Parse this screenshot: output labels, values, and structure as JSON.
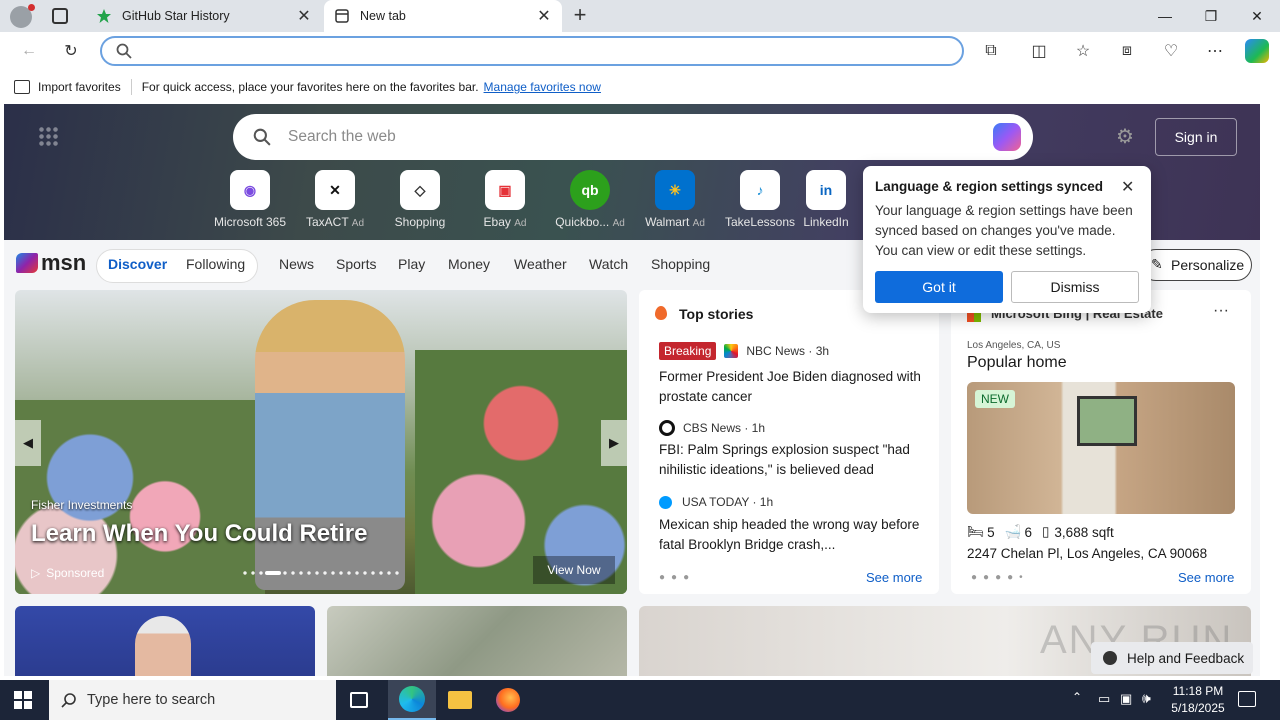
{
  "tabs": [
    {
      "label": "GitHub Star History"
    },
    {
      "label": "New tab"
    }
  ],
  "favbar": {
    "import_label": "Import favorites",
    "message": "For quick access, place your favorites here on the favorites bar.",
    "manage_link": "Manage favorites now"
  },
  "hero": {
    "search_placeholder": "Search the web",
    "signin": "Sign in"
  },
  "quicklinks": [
    {
      "label": "Microsoft 365",
      "ad": ""
    },
    {
      "label": "TaxACT",
      "ad": "Ad"
    },
    {
      "label": "Shopping",
      "ad": ""
    },
    {
      "label": "Ebay",
      "ad": "Ad"
    },
    {
      "label": "Quickbo...",
      "ad": "Ad"
    },
    {
      "label": "Walmart",
      "ad": "Ad"
    },
    {
      "label": "TakeLessons",
      "ad": ""
    },
    {
      "label": "LinkedIn",
      "ad": ""
    }
  ],
  "msn": {
    "logo": "msn",
    "discover": "Discover",
    "following": "Following",
    "personalize": "Personalize",
    "nav": [
      "News",
      "Sports",
      "Play",
      "Money",
      "Weather",
      "Watch",
      "Shopping"
    ]
  },
  "hero_card": {
    "source": "Fisher Investments",
    "headline": "Learn When You Could Retire",
    "sponsored": "Sponsored",
    "cta": "View Now"
  },
  "top_stories": {
    "title": "Top stories",
    "breaking": "Breaking",
    "see_more": "See more",
    "items": [
      {
        "source": "NBC News · 3h",
        "headline": "Former President Joe Biden diagnosed with prostate cancer"
      },
      {
        "source": "CBS News · 1h",
        "headline": "FBI: Palm Springs explosion suspect \"had nihilistic ideations,\" is believed dead"
      },
      {
        "source": "USA TODAY · 1h",
        "headline": "Mexican ship headed the wrong way before fatal Brooklyn Bridge crash,..."
      }
    ]
  },
  "realestate": {
    "title": "Microsoft Bing | Real Estate",
    "location": "Los Angeles, CA, US",
    "heading": "Popular home",
    "badge": "NEW",
    "beds": "5",
    "baths": "6",
    "sqft": "3,688 sqft",
    "address": "2247 Chelan Pl, Los Angeles, CA 90068",
    "see_more": "See more"
  },
  "popup": {
    "title": "Language & region settings synced",
    "body": "Your language & region settings have been synced based on changes you've made. You can view or edit these settings.",
    "got_it": "Got it",
    "dismiss": "Dismiss"
  },
  "help": "Help and Feedback",
  "watermark": "ANY RUN",
  "taskbar": {
    "search_placeholder": "Type here to search",
    "time": "11:18 PM",
    "date": "5/18/2025"
  }
}
